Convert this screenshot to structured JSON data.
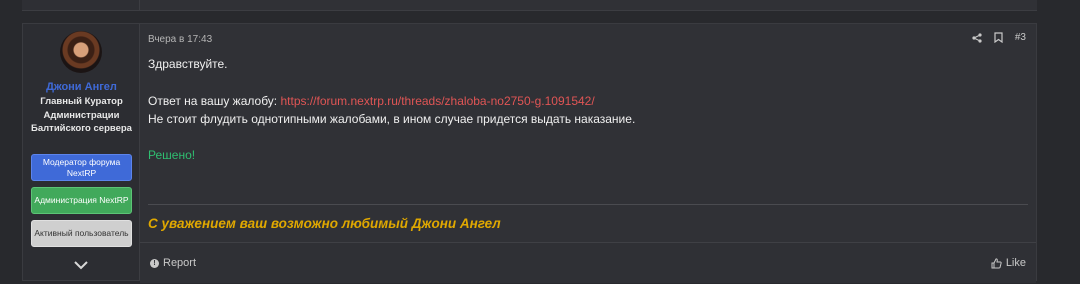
{
  "post": {
    "author": {
      "name": "Джони Ангел",
      "title": "Главный Куратор Администрации Балтийского сервера",
      "banners": [
        "Модератор форума NextRP",
        "Администрация NextRP",
        "Активный пользователь"
      ]
    },
    "date": "Вчера в 17:43",
    "number": "#3",
    "content": {
      "greeting": "Здравствуйте.",
      "reply_prefix": "Ответ на вашу жалобу: ",
      "reply_link": "https://forum.nextrp.ru/threads/zhaloba-no2750-g.1091542/",
      "warning": "Не стоит флудить однотипными жалобами, в ином случае придется выдать наказание.",
      "status": "Решено!",
      "signature": "С уважением ваш возможно любимый Джони Ангел"
    },
    "footer": {
      "report_label": "Report",
      "like_label": "Like"
    }
  },
  "colors": {
    "username": "#3f6ad8",
    "link": "#e05555",
    "solved": "#2fbf71",
    "signature": "#e0a800"
  }
}
